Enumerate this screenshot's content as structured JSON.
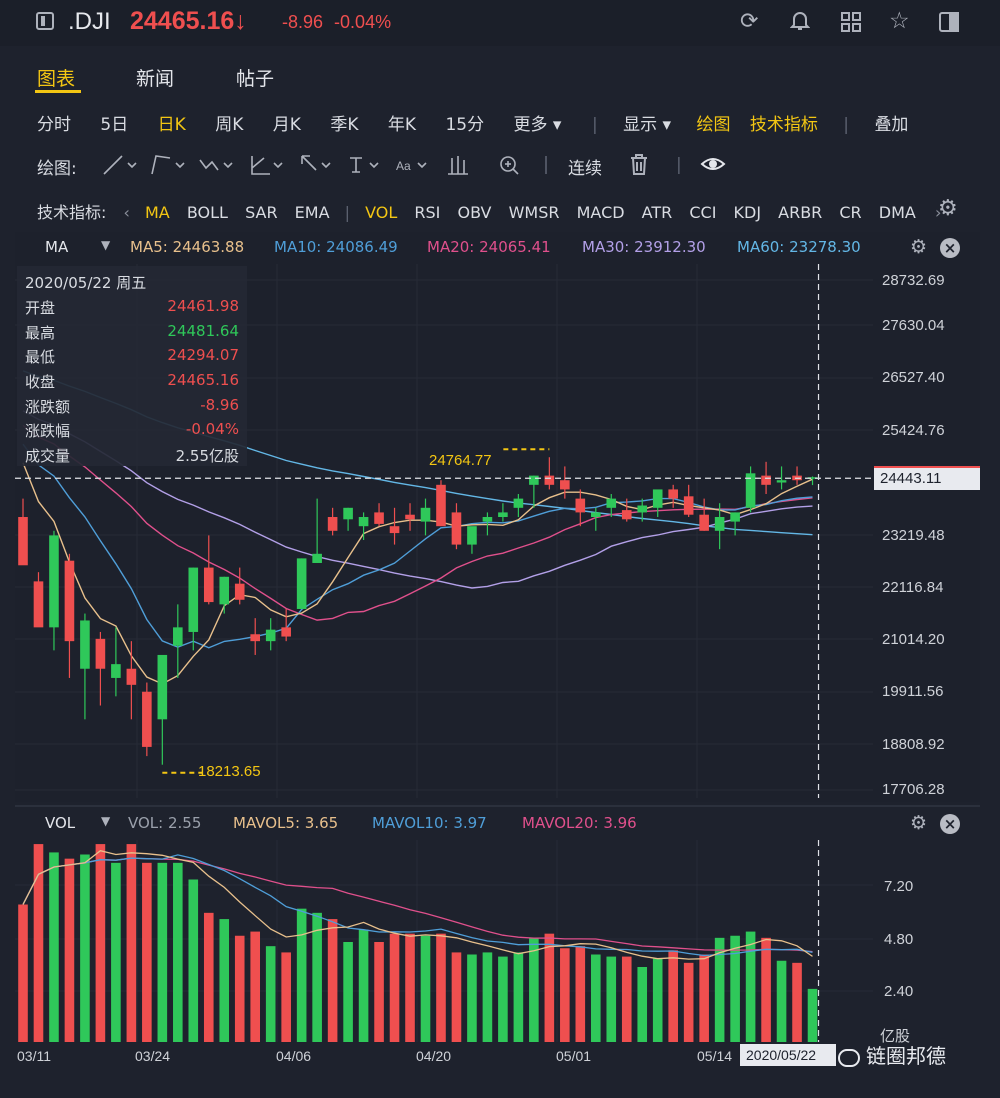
{
  "header": {
    "symbol": ".DJI",
    "price": "24465.16↓",
    "change": "-8.96",
    "change_pct": "-0.04%",
    "icons": [
      "refresh-icon",
      "bell-icon",
      "grid-icon",
      "star-icon",
      "sidebar-icon"
    ]
  },
  "tabs": [
    {
      "label": "图表",
      "active": true
    },
    {
      "label": "新闻",
      "active": false
    },
    {
      "label": "帖子",
      "active": false
    }
  ],
  "periods": [
    "分时",
    "5日",
    "日K",
    "周K",
    "月K",
    "季K",
    "年K",
    "15分",
    "更多 ▾"
  ],
  "period_active": "日K",
  "view_options": {
    "display": "显示 ▾",
    "draw": "绘图",
    "indicators": "技术指标",
    "overlay": "叠加"
  },
  "draw_toolbar": {
    "label": "绘图:",
    "continuous": "连续"
  },
  "indicator_bar": {
    "label": "技术指标:",
    "items": [
      "MA",
      "BOLL",
      "SAR",
      "EMA",
      "VOL",
      "RSI",
      "OBV",
      "WMSR",
      "MACD",
      "ATR",
      "CCI",
      "KDJ",
      "ARBR",
      "CR",
      "DMA"
    ]
  },
  "ma_legend": {
    "name": "MA",
    "ma5": "MA5: 24463.88",
    "ma10": "MA10: 24086.49",
    "ma20": "MA20: 24065.41",
    "ma30": "MA30: 23912.30",
    "ma60": "MA60: 23278.30"
  },
  "info_box": {
    "date": "2020/05/22 周五",
    "rows": [
      {
        "k": "开盘",
        "v": "24461.98",
        "c": "#ef4f4f"
      },
      {
        "k": "最高",
        "v": "24481.64",
        "c": "#2fc85a"
      },
      {
        "k": "最低",
        "v": "24294.07",
        "c": "#ef4f4f"
      },
      {
        "k": "收盘",
        "v": "24465.16",
        "c": "#ef4f4f"
      },
      {
        "k": "涨跌额",
        "v": "-8.96",
        "c": "#ef4f4f"
      },
      {
        "k": "涨跌幅",
        "v": "-0.04%",
        "c": "#ef4f4f"
      },
      {
        "k": "成交量",
        "v": "2.55亿股",
        "c": "#d9dce2"
      }
    ]
  },
  "price_axis": [
    "28732.69",
    "27630.04",
    "26527.40",
    "25424.76",
    "24443.11",
    "23219.48",
    "22116.84",
    "21014.20",
    "19911.56",
    "18808.92",
    "17706.28"
  ],
  "crosshair_price": "24443.11",
  "max_label": "24764.77",
  "min_label": "18213.65",
  "vol_legend": {
    "name": "VOL",
    "vol": "VOL: 2.55",
    "mavol5": "MAVOL5: 3.65",
    "mavol10": "MAVOL10: 3.97",
    "mavol20": "MAVOL20: 3.96"
  },
  "vol_axis": [
    "7.20",
    "4.80",
    "2.40",
    "亿股"
  ],
  "x_axis": [
    "03/11",
    "03/24",
    "04/06",
    "04/20",
    "05/01",
    "05/14"
  ],
  "crosshair_date": "2020/05/22",
  "watermark": "链圈邦德",
  "colors": {
    "up": "#2fc85a",
    "down": "#ef4f4f",
    "accent": "#f3c613",
    "ma5": "#e8c08c",
    "ma10": "#4f9ed8",
    "ma20": "#e0508c",
    "ma30": "#b3a0e8",
    "ma60": "#63b7e6"
  },
  "chart_data": {
    "type": "candlestick",
    "dates": [
      "03/11",
      "03/12",
      "03/13",
      "03/16",
      "03/17",
      "03/18",
      "03/19",
      "03/20",
      "03/23",
      "03/24",
      "03/25",
      "03/26",
      "03/27",
      "03/30",
      "03/31",
      "04/01",
      "04/02",
      "04/03",
      "04/06",
      "04/07",
      "04/08",
      "04/09",
      "04/13",
      "04/14",
      "04/15",
      "04/16",
      "04/17",
      "04/20",
      "04/21",
      "04/22",
      "04/23",
      "04/24",
      "04/27",
      "04/28",
      "04/29",
      "04/30",
      "05/01",
      "05/04",
      "05/05",
      "05/06",
      "05/07",
      "05/08",
      "05/11",
      "05/12",
      "05/13",
      "05/14",
      "05/15",
      "05/18",
      "05/19",
      "05/20",
      "05/21",
      "05/22"
    ],
    "open": [
      23600,
      22200,
      21200,
      22650,
      20300,
      20950,
      20100,
      20300,
      19800,
      19200,
      20800,
      21100,
      22500,
      21700,
      22150,
      21050,
      20900,
      21200,
      21600,
      22600,
      23600,
      23550,
      23400,
      23700,
      23400,
      23650,
      23500,
      24300,
      23700,
      23000,
      23500,
      23600,
      23800,
      24300,
      24500,
      24400,
      24000,
      23600,
      23800,
      23750,
      23700,
      23800,
      24200,
      24050,
      23650,
      23300,
      23500,
      23800,
      24500,
      24350,
      24500,
      24462
    ],
    "high": [
      24000,
      22400,
      23300,
      22800,
      21500,
      21100,
      21200,
      20900,
      20000,
      19900,
      21700,
      22500,
      23200,
      22300,
      22500,
      21400,
      21400,
      21600,
      22700,
      24000,
      23800,
      23800,
      23700,
      23900,
      23800,
      23900,
      24000,
      24400,
      23900,
      23300,
      23700,
      23900,
      24100,
      24500,
      24900,
      24700,
      24200,
      23800,
      24100,
      24000,
      24000,
      24100,
      24300,
      24300,
      24000,
      23900,
      23700,
      24700,
      24800,
      24700,
      24700,
      24482
    ],
    "low": [
      23200,
      21800,
      20700,
      20100,
      19200,
      19500,
      19700,
      19200,
      18400,
      18213,
      20100,
      20700,
      21700,
      21500,
      21700,
      20600,
      20700,
      20900,
      21600,
      22600,
      23200,
      23300,
      23100,
      23400,
      23000,
      23300,
      23200,
      23500,
      22900,
      22800,
      23200,
      23500,
      23600,
      23800,
      24200,
      24000,
      23400,
      23300,
      23600,
      23500,
      23500,
      23600,
      23800,
      23600,
      23300,
      22900,
      23200,
      23700,
      24100,
      24200,
      24300,
      24294
    ],
    "close": [
      22550,
      21200,
      23200,
      20900,
      21350,
      20300,
      20400,
      19950,
      18600,
      20600,
      21200,
      22500,
      21750,
      22300,
      21800,
      20900,
      21150,
      21000,
      22700,
      22800,
      23300,
      23800,
      23600,
      23450,
      23250,
      23550,
      23800,
      23400,
      23000,
      23400,
      23600,
      23700,
      24000,
      24500,
      24300,
      24200,
      23700,
      23700,
      24000,
      23550,
      23850,
      24200,
      24000,
      23650,
      23300,
      23600,
      23700,
      24550,
      24300,
      24400,
      24400,
      24465
    ],
    "volume": [
      6.6,
      9.5,
      9.1,
      8.8,
      9.0,
      9.5,
      8.6,
      9.5,
      8.6,
      8.6,
      8.6,
      7.8,
      6.2,
      5.9,
      5.1,
      5.3,
      4.6,
      4.3,
      6.4,
      6.2,
      5.9,
      4.8,
      5.4,
      4.8,
      5.2,
      5.2,
      5.1,
      5.2,
      4.3,
      4.2,
      4.3,
      4.1,
      4.3,
      5.0,
      5.2,
      4.5,
      4.6,
      4.2,
      4.1,
      4.1,
      3.6,
      4.0,
      4.4,
      3.8,
      4.2,
      5.0,
      5.1,
      5.3,
      5.0,
      3.9,
      3.8,
      2.55
    ],
    "ylim": [
      17706.28,
      28732.69
    ],
    "vol_ylim": [
      0,
      9.6
    ]
  }
}
